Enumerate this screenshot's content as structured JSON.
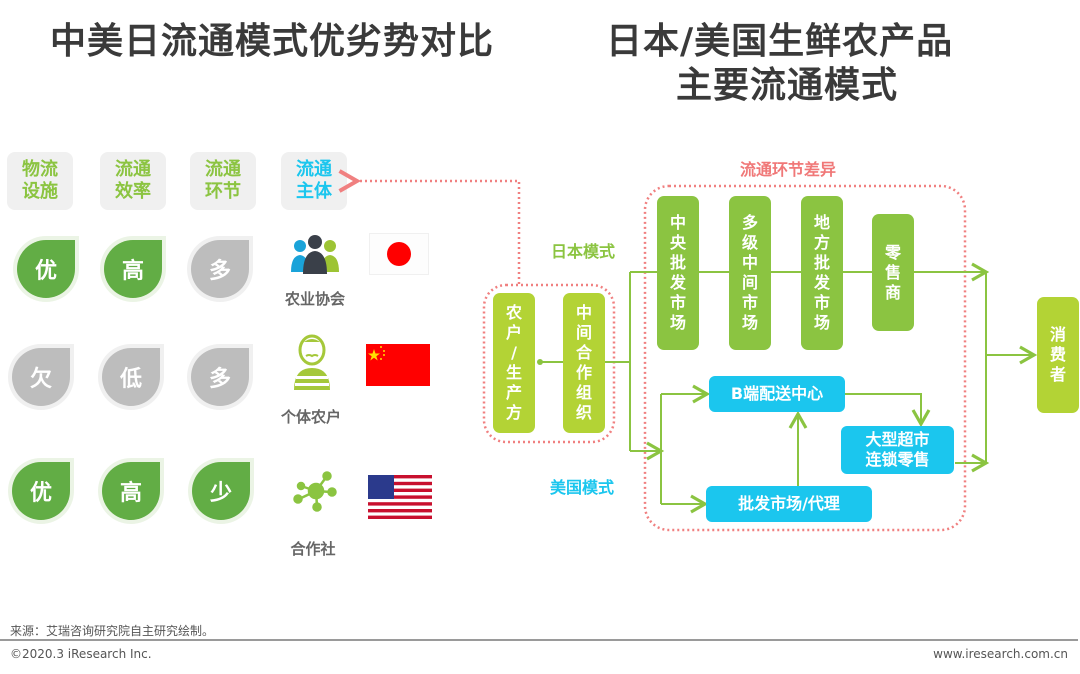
{
  "titles": {
    "left": "中美日流通模式优劣势对比",
    "right_line1": "日本/美国生鲜农产品",
    "right_line2": "主要流通模式"
  },
  "comparison": {
    "headers": [
      {
        "line1": "物流",
        "line2": "设施",
        "color": "#8bc441"
      },
      {
        "line1": "流通",
        "line2": "效率",
        "color": "#8bc441"
      },
      {
        "line1": "流通",
        "line2": "环节",
        "color": "#8bc441"
      },
      {
        "line1": "流通",
        "line2": "主体",
        "color": "#1bc6ee"
      }
    ],
    "rows": [
      {
        "country": "Japan",
        "flag": "japan-flag",
        "values": [
          "优",
          "高",
          "多"
        ],
        "styles": [
          "green",
          "green",
          "gray"
        ],
        "entity": "农业协会",
        "entity_icon": "people-group-icon"
      },
      {
        "country": "China",
        "flag": "china-flag",
        "values": [
          "欠",
          "低",
          "多"
        ],
        "styles": [
          "gray",
          "gray",
          "gray"
        ],
        "entity": "个体农户",
        "entity_icon": "farmer-icon"
      },
      {
        "country": "USA",
        "flag": "usa-flag",
        "values": [
          "优",
          "高",
          "少"
        ],
        "styles": [
          "green",
          "green",
          "green"
        ],
        "entity": "合作社",
        "entity_icon": "network-icon"
      }
    ]
  },
  "flow": {
    "difference_label": "流通环节差异",
    "japan_mode": "日本模式",
    "us_mode": "美国模式",
    "origin": [
      "农户/生产方",
      "中间合作组织"
    ],
    "japan_nodes": [
      "中央批发市场",
      "多级中间市场",
      "地方批发市场",
      "零售商"
    ],
    "us_nodes": {
      "b2b_center": "B端配送中心",
      "wholesale": "批发市场/代理",
      "supermarket_line1": "大型超市",
      "supermarket_line2": "连锁零售"
    },
    "consumer": "消费者"
  },
  "colors": {
    "green_dark": "#8bc441",
    "green_light": "#b3d335",
    "blue": "#1bc6ee",
    "pink_dotted": "#f08080",
    "leaf_green": "#62ad45",
    "leaf_gray": "#bdbdbd"
  },
  "footer": {
    "source": "来源：艾瑞咨询研究院自主研究绘制。",
    "copyright": "©2020.3 iResearch Inc.",
    "url": "www.iresearch.com.cn"
  }
}
